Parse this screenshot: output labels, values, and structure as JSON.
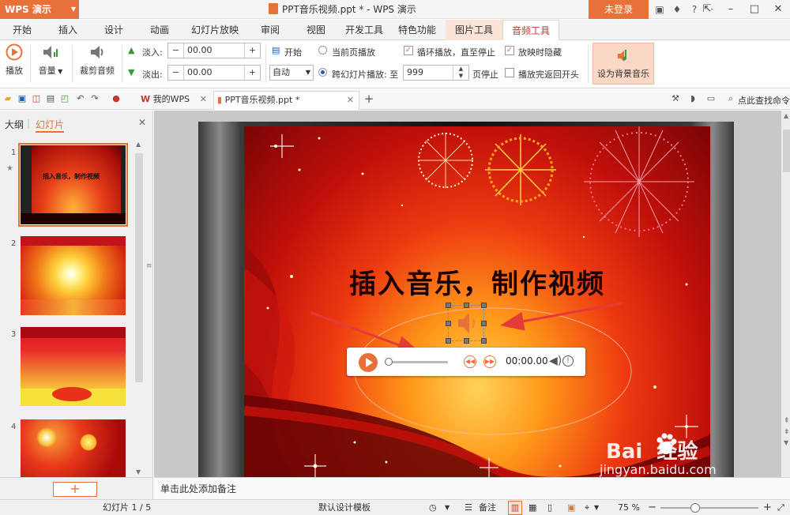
{
  "app": {
    "name": "WPS 演示",
    "title": "PPT音乐视频.ppt * - WPS 演示",
    "login": "未登录"
  },
  "menu_tabs": [
    {
      "label": "开始"
    },
    {
      "label": "插入"
    },
    {
      "label": "设计"
    },
    {
      "label": "动画"
    },
    {
      "label": "幻灯片放映"
    },
    {
      "label": "审阅"
    },
    {
      "label": "视图"
    },
    {
      "label": "开发工具"
    },
    {
      "label": "特色功能"
    },
    {
      "label": "图片工具"
    },
    {
      "label": "音频工具"
    }
  ],
  "ribbon": {
    "play": "播放",
    "volume": "音量",
    "trim": "裁剪音频",
    "fade_in_label": "淡入:",
    "fade_in_value": "00.00",
    "fade_out_label": "淡出:",
    "fade_out_value": "00.00",
    "start_label": "开始",
    "start_select": "自动",
    "current_page": "当前页播放",
    "cross_slide": "跨幻灯片播放: 至",
    "cross_slide_value": "999",
    "page_stop": "页停止",
    "loop": "循环播放，直至停止",
    "rewind": "播放完返回开头",
    "hide_during": "放映时隐藏",
    "set_bg_music": "设为背景音乐",
    "checks": {
      "loop": true,
      "hide_during": true,
      "rewind": false
    },
    "radios": {
      "current_page": false,
      "cross_slide": true
    }
  },
  "doc_tabs": [
    {
      "label": "我的WPS"
    },
    {
      "label": "PPT音乐视频.ppt *"
    }
  ],
  "search_cmd": "点此查找命令",
  "panel": {
    "outline": "大纲",
    "slides": "幻灯片"
  },
  "slide_numbers": [
    "1",
    "2",
    "3",
    "4"
  ],
  "thumb1_title": "插入音乐，制作视频",
  "slide": {
    "title": "插入音乐，制作视频",
    "player_time": "00:00.00"
  },
  "notes_placeholder": "单击此处添加备注",
  "status": {
    "slide_count": "幻灯片 1 / 5",
    "template": "默认设计模板",
    "notes": "备注",
    "zoom": "75 %"
  },
  "watermark": {
    "brand": "Bai  经验",
    "url": "jingyan.baidu.com"
  },
  "colors": {
    "accent": "#e8713a",
    "arrow": "#e63a3a"
  }
}
